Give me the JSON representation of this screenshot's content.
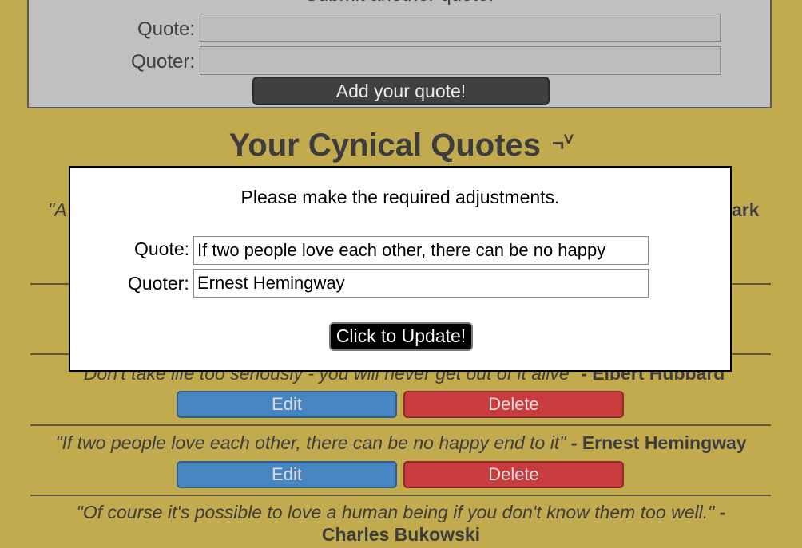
{
  "submit_form": {
    "title": "Submit another quote:",
    "quote_label": "Quote:",
    "quoter_label": "Quoter:",
    "quote_value": "",
    "quoter_value": "",
    "add_button": "Add your quote!"
  },
  "heading": {
    "title": "Your Cynical Quotes",
    "emoticon": "¬ⱽ"
  },
  "partial_behind_modal": {
    "left_fragment": "\"A",
    "right_fragment": "ark"
  },
  "quotes": [
    {
      "text": "\"Don't take life too seriously - you will never get out of it alive\"",
      "author": "- Elbert Hubbard",
      "edit": "Edit",
      "delete": "Delete"
    },
    {
      "text": "\"If two people love each other, there can be no happy end to it\"",
      "author": "- Ernest Hemingway",
      "edit": "Edit",
      "delete": "Delete"
    },
    {
      "text": "\"Of course it's possible to love a human being if you don't know them too well.\"",
      "author_dash": "-",
      "author": "Charles Bukowski"
    }
  ],
  "modal": {
    "title": "Please make the required adjustments.",
    "quote_label": "Quote:",
    "quoter_label": "Quoter:",
    "quote_value": "If two people love each other, there can be no happy",
    "quoter_value": "Ernest Hemingway",
    "update_button": "Click to Update!"
  },
  "colors": {
    "background": "#c2ab4f",
    "edit": "#4785c0",
    "delete": "#c83c3e",
    "modal": "#ffffff"
  }
}
